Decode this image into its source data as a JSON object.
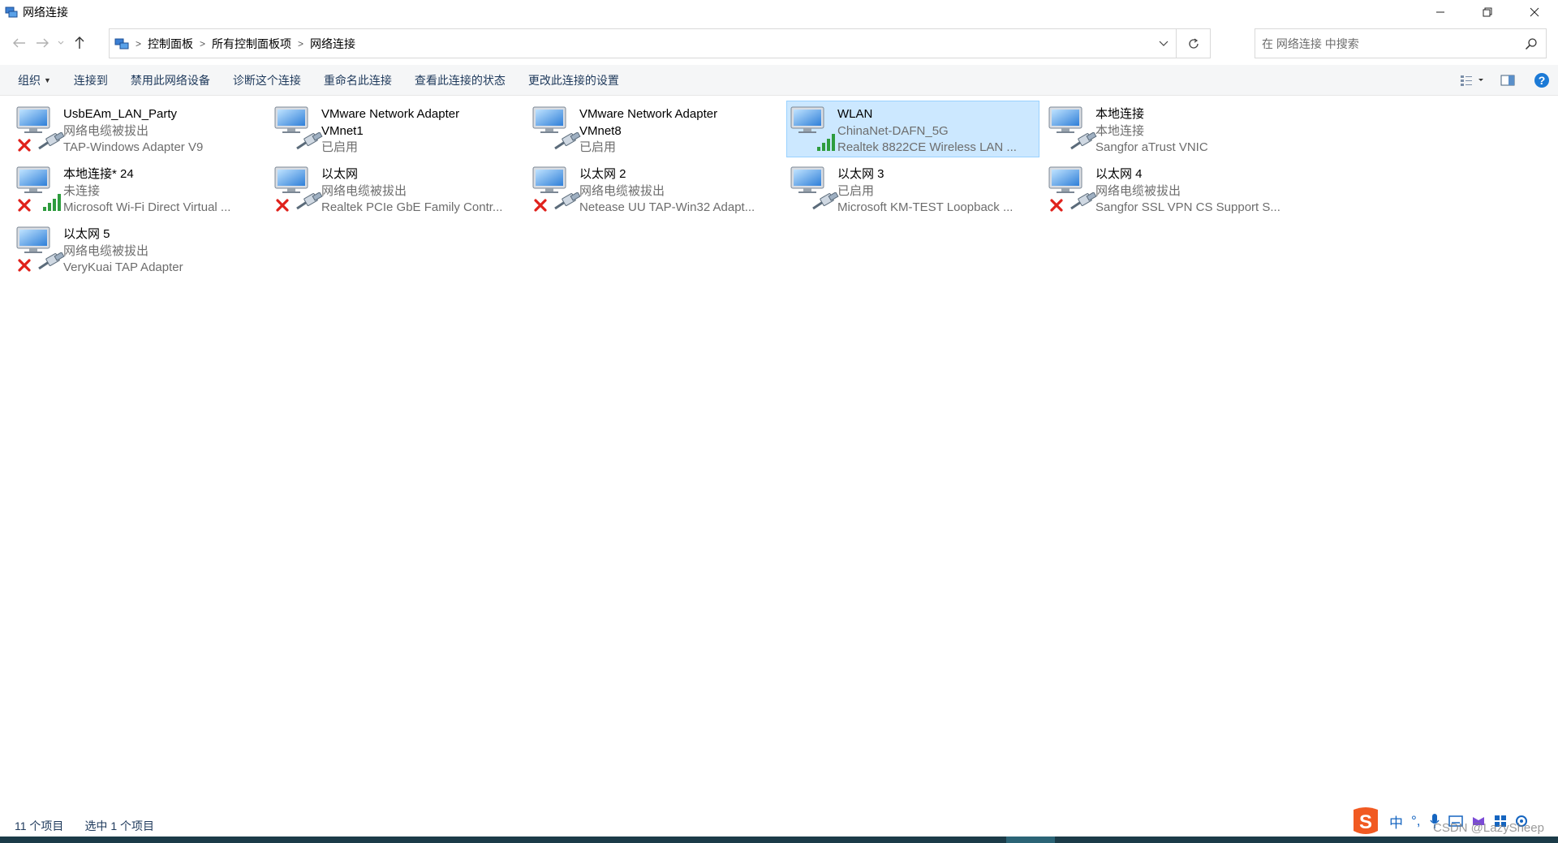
{
  "window": {
    "title": "网络连接",
    "controls": [
      "minimize",
      "restore",
      "close"
    ]
  },
  "address": {
    "breadcrumbs": [
      "控制面板",
      "所有控制面板项",
      "网络连接"
    ]
  },
  "search": {
    "placeholder": "在 网络连接 中搜索"
  },
  "toolbar": {
    "organize": "组织",
    "connect_to": "连接到",
    "disable": "禁用此网络设备",
    "diagnose": "诊断这个连接",
    "rename": "重命名此连接",
    "view_status": "查看此连接的状态",
    "change_settings": "更改此连接的设置"
  },
  "connections": [
    {
      "name": "UsbEAm_LAN_Party",
      "status": "网络电缆被拔出",
      "device": "TAP-Windows Adapter V9",
      "badge": "disconnected-cable"
    },
    {
      "name": "VMware Network Adapter VMnet1",
      "status": "已启用",
      "device": "",
      "badge": "cable"
    },
    {
      "name": "VMware Network Adapter VMnet8",
      "status": "已启用",
      "device": "",
      "badge": "cable"
    },
    {
      "name": "WLAN",
      "status": "ChinaNet-DAFN_5G",
      "device": "Realtek 8822CE Wireless LAN ...",
      "badge": "signal",
      "selected": true
    },
    {
      "name": "本地连接",
      "status": "本地连接",
      "device": "Sangfor aTrust VNIC",
      "badge": "cable"
    },
    {
      "name": "本地连接* 24",
      "status": "未连接",
      "device": "Microsoft Wi-Fi Direct Virtual ...",
      "badge": "disconnected-signal"
    },
    {
      "name": "以太网",
      "status": "网络电缆被拔出",
      "device": "Realtek PCIe GbE Family Contr...",
      "badge": "disconnected-cable"
    },
    {
      "name": "以太网 2",
      "status": "网络电缆被拔出",
      "device": "Netease UU TAP-Win32 Adapt...",
      "badge": "disconnected-cable"
    },
    {
      "name": "以太网 3",
      "status": "已启用",
      "device": "Microsoft KM-TEST Loopback ...",
      "badge": "cable"
    },
    {
      "name": "以太网 4",
      "status": "网络电缆被拔出",
      "device": "Sangfor SSL VPN CS Support S...",
      "badge": "disconnected-cable"
    },
    {
      "name": "以太网 5",
      "status": "网络电缆被拔出",
      "device": "VeryKuai TAP Adapter",
      "badge": "disconnected-cable"
    }
  ],
  "statusbar": {
    "item_count": "11 个项目",
    "selected_count": "选中 1 个项目"
  },
  "tray": {
    "ime_lang": "中",
    "watermark": "CSDN @LazySheep"
  },
  "colors": {
    "selection_bg": "#cce8ff",
    "selection_border": "#99d1ff",
    "command_text": "#1e395b",
    "status_gray": "#6d6d6d"
  }
}
